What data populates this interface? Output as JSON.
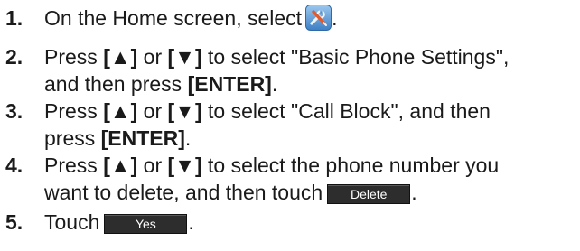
{
  "steps": [
    {
      "number": "1.",
      "text_before_icon": "On the Home screen, select",
      "icon": "tools-app-icon",
      "text_after_icon": "."
    },
    {
      "number": "2.",
      "press": "Press",
      "up_key": "[▲]",
      "or": "or",
      "down_key": "[▼]",
      "line1_rest": "to select \"Basic Phone Settings\",",
      "line2_before": "and then press",
      "enter_key": "[ENTER]",
      "line2_after": "."
    },
    {
      "number": "3.",
      "press": "Press",
      "up_key": "[▲]",
      "or": "or",
      "down_key": "[▼]",
      "line1_rest": "to select \"Call Block\", and then",
      "line2_before": "press",
      "enter_key": "[ENTER]",
      "line2_after": "."
    },
    {
      "number": "4.",
      "press": "Press",
      "up_key": "[▲]",
      "or": "or",
      "down_key": "[▼]",
      "line1_rest": "to select the phone number you",
      "line2_before": "want to delete, and then touch",
      "button_label": "Delete",
      "line2_after": "."
    },
    {
      "number": "5.",
      "text_before_button": "Touch",
      "button_label": "Yes",
      "text_after_button": "."
    }
  ],
  "colors": {
    "text": "#1a1a1a",
    "button_bg": "#2d2d2d",
    "button_text": "#ffffff",
    "icon_bg": "#6aa6e0"
  }
}
